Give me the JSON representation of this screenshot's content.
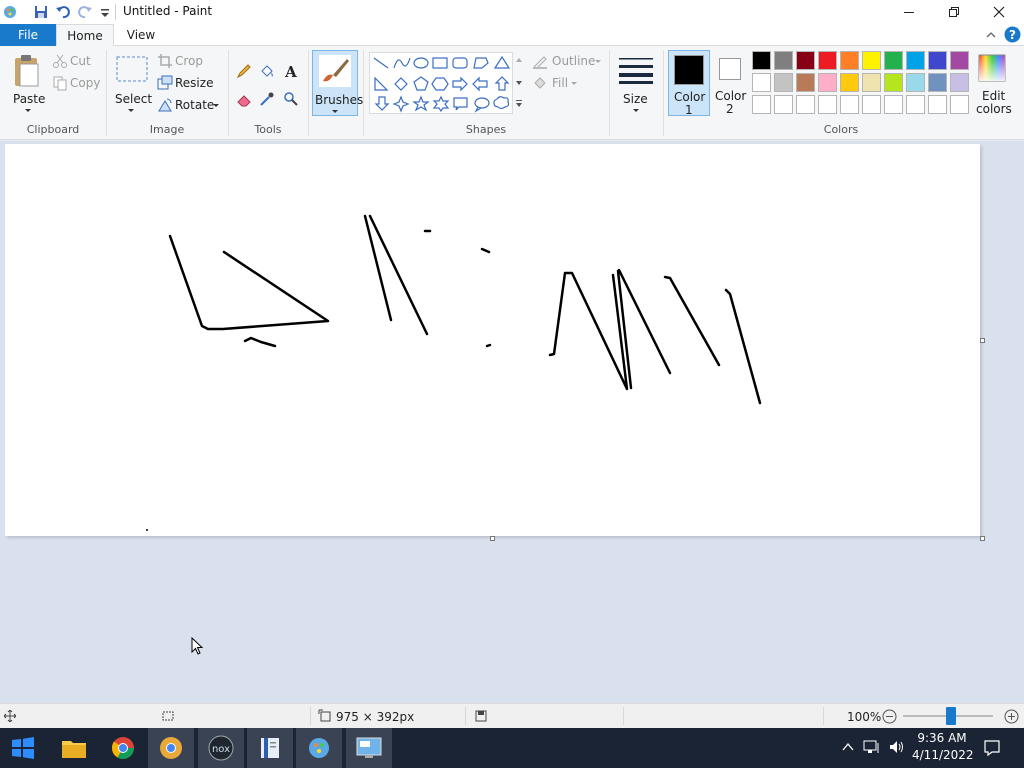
{
  "window": {
    "title": "Untitled - Paint"
  },
  "tabs": [
    {
      "label": "File"
    },
    {
      "label": "Home"
    },
    {
      "label": "View"
    }
  ],
  "ribbon": {
    "clipboard": {
      "paste": "Paste",
      "cut": "Cut",
      "copy": "Copy",
      "group": "Clipboard"
    },
    "image": {
      "select": "Select",
      "crop": "Crop",
      "resize": "Resize",
      "rotate": "Rotate",
      "group": "Image"
    },
    "tools": {
      "group": "Tools"
    },
    "brushes": {
      "label": "Brushes"
    },
    "shapes": {
      "outline": "Outline",
      "fill": "Fill",
      "group": "Shapes"
    },
    "size": {
      "label": "Size"
    },
    "colors": {
      "color1": "Color\n1",
      "color1_line1": "Color",
      "color1_line2": "1",
      "color2_line1": "Color",
      "color2_line2": "2",
      "edit_line1": "Edit",
      "edit_line2": "colors",
      "group": "Colors",
      "color1_value": "#000000",
      "color2_value": "#ffffff",
      "palette_row1": [
        "#000000",
        "#7f7f7f",
        "#880015",
        "#ed1c24",
        "#ff7f27",
        "#fff200",
        "#22b14c",
        "#00a2e8",
        "#3f48cc",
        "#a349a4"
      ],
      "palette_row2": [
        "#ffffff",
        "#c3c3c3",
        "#b97a57",
        "#ffaec9",
        "#ffc90e",
        "#efe4b0",
        "#b5e61d",
        "#99d9ea",
        "#7092be",
        "#c8bfe7"
      ],
      "palette_row3": [
        "#ffffff",
        "#ffffff",
        "#ffffff",
        "#ffffff",
        "#ffffff",
        "#ffffff",
        "#ffffff",
        "#ffffff",
        "#ffffff",
        "#ffffff"
      ]
    }
  },
  "status": {
    "canvas_size": "975 × 392px",
    "zoom": "100%"
  },
  "taskbar": {
    "time": "9:36 AM",
    "date": "4/11/2022"
  }
}
